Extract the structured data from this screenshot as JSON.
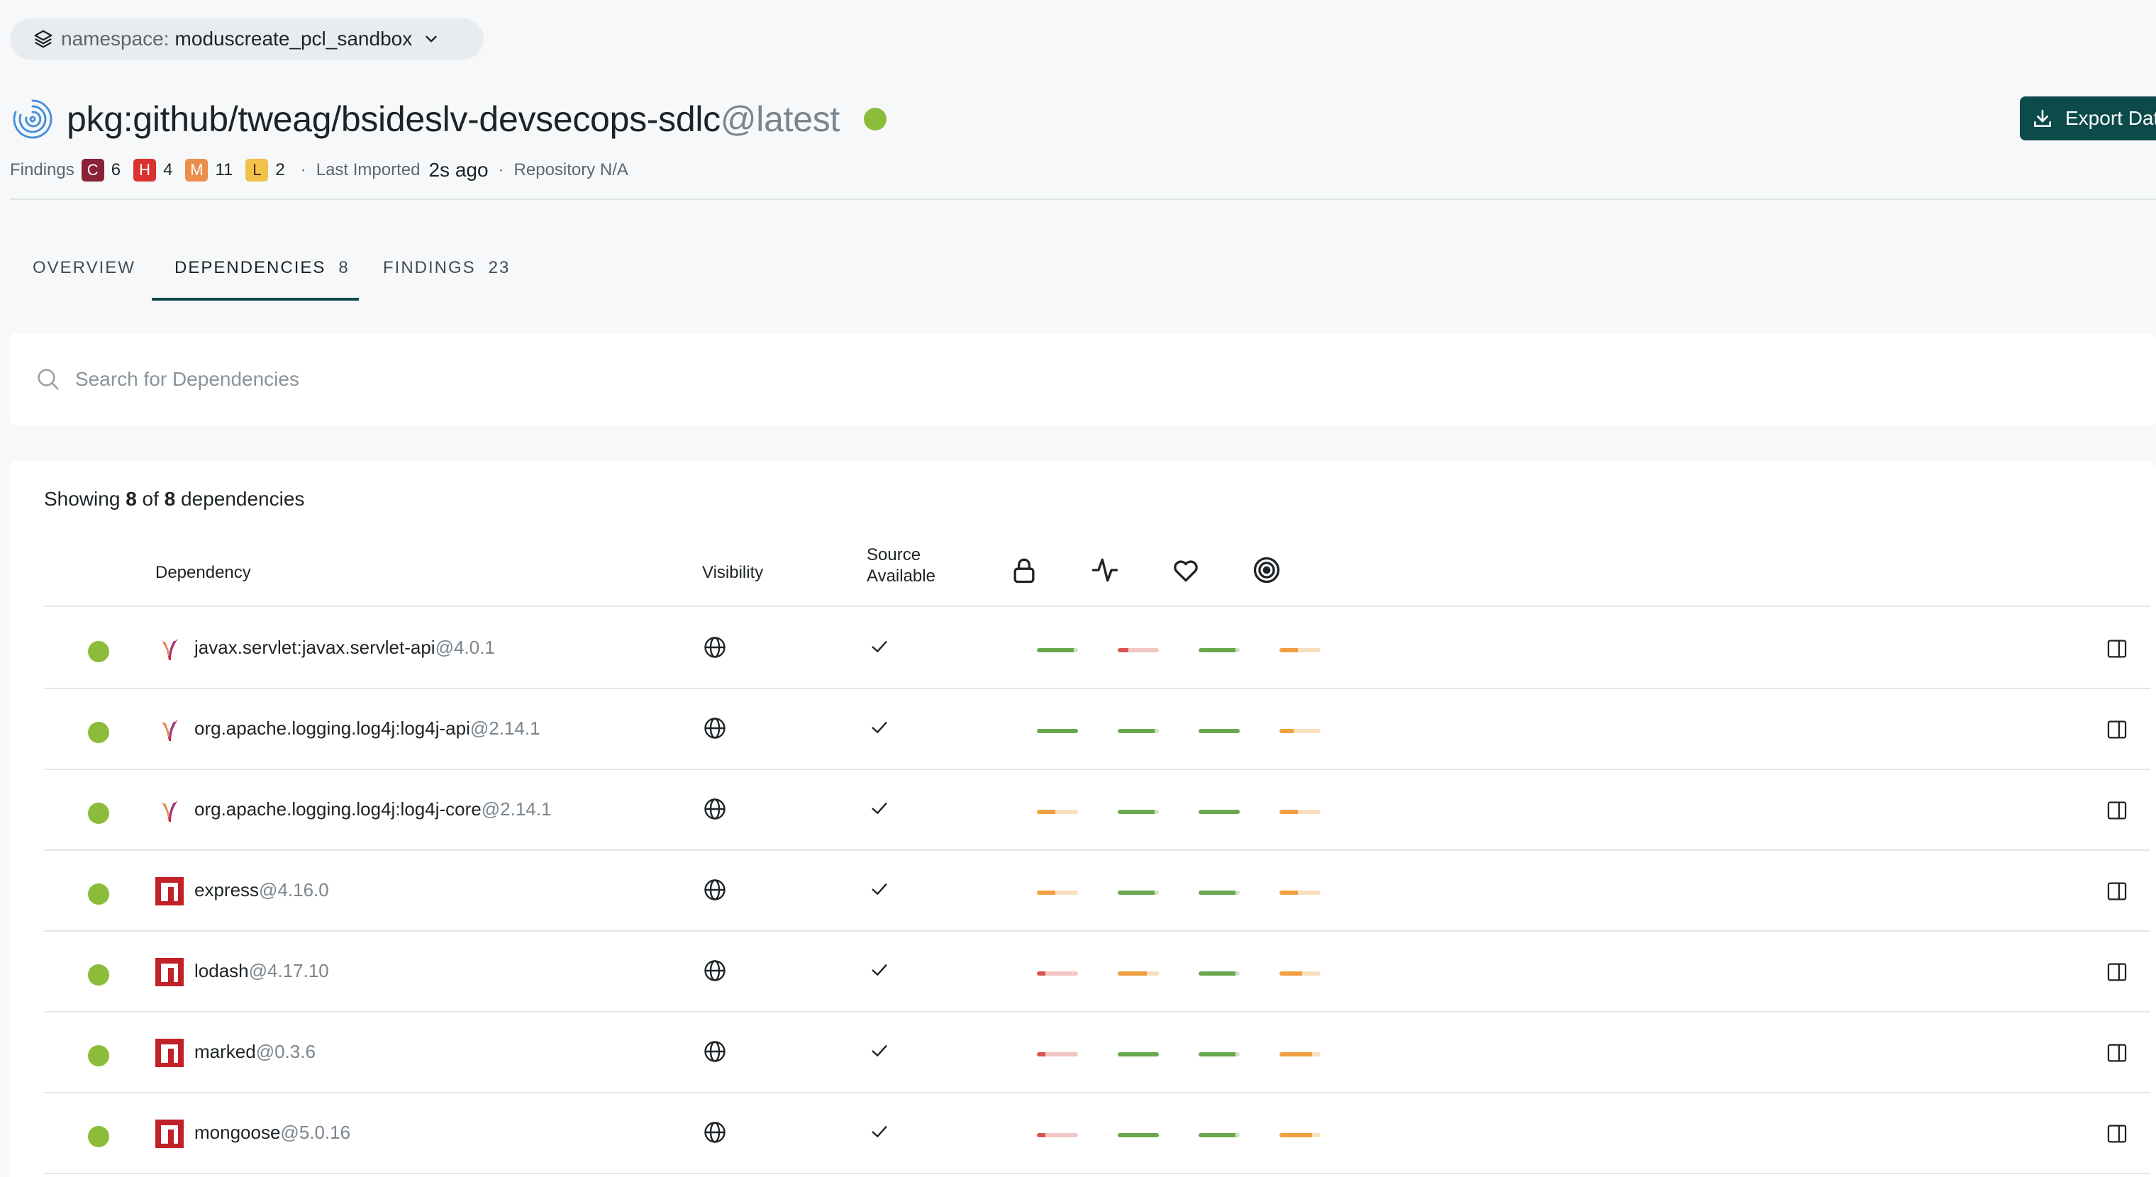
{
  "namespace": {
    "label": "namespace:",
    "value": "moduscreate_pcl_sandbox"
  },
  "package": {
    "name": "pkg:github/tweag/bsideslv-devsecops-sdlc",
    "version": "@latest",
    "status_color": "#8cbd3a"
  },
  "export_label": "Export Data",
  "meta": {
    "findings_label": "Findings",
    "severities": [
      {
        "letter": "C",
        "count": "6",
        "color": "#8a2135"
      },
      {
        "letter": "H",
        "count": "4",
        "color": "#d9322f"
      },
      {
        "letter": "M",
        "count": "11",
        "color": "#ec8e4a"
      },
      {
        "letter": "L",
        "count": "2",
        "color": "#f2c14a"
      }
    ],
    "separator": "·",
    "last_imported_label": "Last Imported",
    "last_imported_value": "2s ago",
    "repository_label": "Repository N/A"
  },
  "tabs": [
    {
      "label": "OVERVIEW",
      "count": ""
    },
    {
      "label": "DEPENDENCIES",
      "count": "8"
    },
    {
      "label": "FINDINGS",
      "count": "23"
    }
  ],
  "search": {
    "placeholder": "Search for Dependencies"
  },
  "showing": {
    "prefix": "Showing",
    "shown": "8",
    "of": "of",
    "total": "8",
    "suffix": "dependencies"
  },
  "columns": {
    "dependency": "Dependency",
    "visibility": "Visibility",
    "source_line1": "Source",
    "source_line2": "Available",
    "score_icons": [
      "lock-icon",
      "activity-icon",
      "heart-icon",
      "target-icon"
    ]
  },
  "colors": {
    "green": "#6aa84f",
    "orange": "#f0a040",
    "red": "#d9534f",
    "accent": "#0d4a4a"
  },
  "dependencies": [
    {
      "name": "javax.servlet:javax.servlet-api",
      "version": "@4.0.1",
      "ecosystem": "maven",
      "scores": [
        {
          "level": "green",
          "fill": 0.9
        },
        {
          "level": "red",
          "fill": 0.25
        },
        {
          "level": "green",
          "fill": 0.9
        },
        {
          "level": "orange",
          "fill": 0.45
        }
      ]
    },
    {
      "name": "org.apache.logging.log4j:log4j-api",
      "version": "@2.14.1",
      "ecosystem": "maven",
      "scores": [
        {
          "level": "green",
          "fill": 1.0
        },
        {
          "level": "green",
          "fill": 0.9
        },
        {
          "level": "green",
          "fill": 1.0
        },
        {
          "level": "orange",
          "fill": 0.35
        }
      ]
    },
    {
      "name": "org.apache.logging.log4j:log4j-core",
      "version": "@2.14.1",
      "ecosystem": "maven",
      "scores": [
        {
          "level": "orange",
          "fill": 0.45
        },
        {
          "level": "green",
          "fill": 0.9
        },
        {
          "level": "green",
          "fill": 1.0
        },
        {
          "level": "orange",
          "fill": 0.45
        }
      ]
    },
    {
      "name": "express",
      "version": "@4.16.0",
      "ecosystem": "npm",
      "scores": [
        {
          "level": "orange",
          "fill": 0.45
        },
        {
          "level": "green",
          "fill": 0.9
        },
        {
          "level": "green",
          "fill": 0.9
        },
        {
          "level": "orange",
          "fill": 0.45
        }
      ]
    },
    {
      "name": "lodash",
      "version": "@4.17.10",
      "ecosystem": "npm",
      "scores": [
        {
          "level": "red",
          "fill": 0.2
        },
        {
          "level": "orange",
          "fill": 0.7
        },
        {
          "level": "green",
          "fill": 0.9
        },
        {
          "level": "orange",
          "fill": 0.55
        }
      ]
    },
    {
      "name": "marked",
      "version": "@0.3.6",
      "ecosystem": "npm",
      "scores": [
        {
          "level": "red",
          "fill": 0.2
        },
        {
          "level": "green",
          "fill": 1.0
        },
        {
          "level": "green",
          "fill": 0.9
        },
        {
          "level": "orange",
          "fill": 0.8
        }
      ]
    },
    {
      "name": "mongoose",
      "version": "@5.0.16",
      "ecosystem": "npm",
      "scores": [
        {
          "level": "red",
          "fill": 0.2
        },
        {
          "level": "green",
          "fill": 1.0
        },
        {
          "level": "green",
          "fill": 0.9
        },
        {
          "level": "orange",
          "fill": 0.8
        }
      ]
    }
  ]
}
